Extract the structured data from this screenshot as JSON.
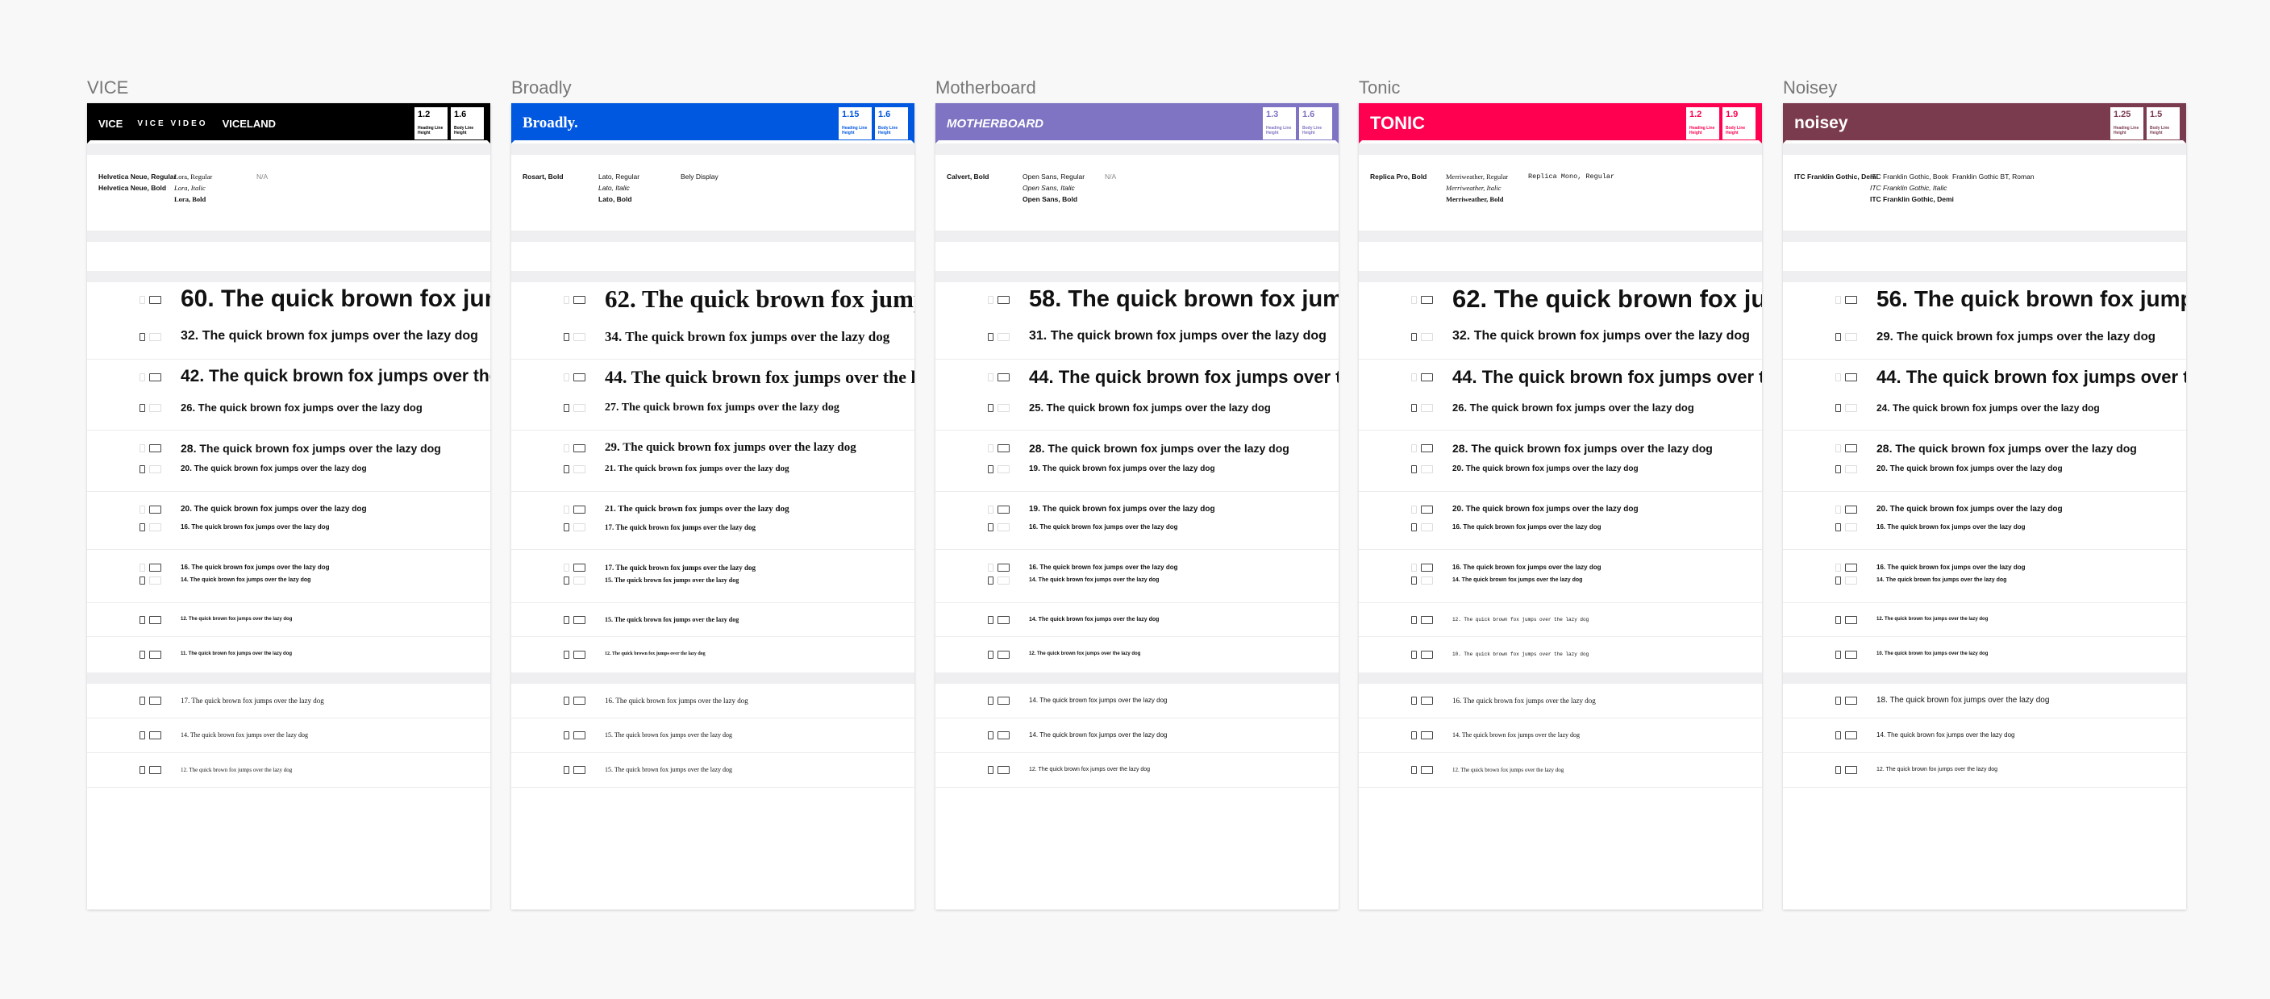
{
  "sample_text": "The quick brown fox jumps over the lazy dog",
  "cards": [
    {
      "id": "vice",
      "label": "VICE",
      "banner_color": "#000000",
      "logo_color": "#ffffff",
      "logo": [
        "VICE",
        "VICE VIDEO",
        "VICELAND"
      ],
      "metrics": [
        {
          "value": "1.2",
          "label": "Heading Line Height"
        },
        {
          "value": "1.6",
          "label": "Body Line Height"
        }
      ],
      "families": {
        "headline": [
          "Helvetica Neue, Regular",
          "Helvetica Neue, Bold"
        ],
        "body": [
          "Lora, Regular",
          "Lora, Italic",
          "Lora, Bold"
        ],
        "ui": [
          "N/A"
        ]
      },
      "accent": "#999999",
      "headings": [
        [
          "60",
          "32"
        ],
        [
          "42",
          "26"
        ],
        [
          "28",
          "20"
        ],
        [
          "20",
          "16"
        ],
        [
          "16",
          "14"
        ],
        [
          "12"
        ],
        [
          "11"
        ]
      ],
      "body": [
        "17",
        "14",
        "12"
      ]
    },
    {
      "id": "broadly",
      "label": "Broadly",
      "banner_color": "#0057e0",
      "logo_color": "#ffffff",
      "logo": [
        "Broadly."
      ],
      "metrics": [
        {
          "value": "1.15",
          "label": "Heading Line Height"
        },
        {
          "value": "1.6",
          "label": "Body Line Height"
        }
      ],
      "families": {
        "headline": [
          "Rosart, Bold"
        ],
        "body": [
          "Lato, Regular",
          "Lato, Italic",
          "Lato, Bold"
        ],
        "ui": [
          "Bely Display"
        ]
      },
      "accent": "#0057e0",
      "headings": [
        [
          "62",
          "34"
        ],
        [
          "44",
          "27"
        ],
        [
          "29",
          "21"
        ],
        [
          "21",
          "17"
        ],
        [
          "17",
          "15"
        ],
        [
          "15"
        ],
        [
          "12"
        ]
      ],
      "body": [
        "16",
        "15",
        "15"
      ]
    },
    {
      "id": "motherboard",
      "label": "Motherboard",
      "banner_color": "#7e74c3",
      "logo_color": "#ffffff",
      "logo": [
        "MOTHERBOARD"
      ],
      "metrics": [
        {
          "value": "1.3",
          "label": "Heading Line Height"
        },
        {
          "value": "1.6",
          "label": "Body Line Height"
        }
      ],
      "families": {
        "headline": [
          "Calvert, Bold"
        ],
        "body": [
          "Open Sans, Regular",
          "Open Sans, Italic",
          "Open Sans, Bold"
        ],
        "ui": [
          "N/A"
        ]
      },
      "accent": "#7e74c3",
      "headings": [
        [
          "58",
          "31"
        ],
        [
          "44",
          "25"
        ],
        [
          "28",
          "19"
        ],
        [
          "19",
          "16"
        ],
        [
          "16",
          "14"
        ],
        [
          "14"
        ],
        [
          "12"
        ]
      ],
      "body": [
        "14",
        "14",
        "12"
      ]
    },
    {
      "id": "tonic",
      "label": "Tonic",
      "banner_color": "#ff0050",
      "logo_color": "#ffffff",
      "logo": [
        "TONIC"
      ],
      "metrics": [
        {
          "value": "1.2",
          "label": "Heading Line Height"
        },
        {
          "value": "1.9",
          "label": "Body Line Height"
        }
      ],
      "families": {
        "headline": [
          "Replica Pro, Bold"
        ],
        "body": [
          "Merriweather, Regular",
          "Merriweather, Italic",
          "Merriweather, Bold"
        ],
        "ui": [
          "Replica Mono, Regular"
        ]
      },
      "accent": "#ff0050",
      "headings": [
        [
          "62",
          "32"
        ],
        [
          "44",
          "26"
        ],
        [
          "28",
          "20"
        ],
        [
          "20",
          "16"
        ],
        [
          "16",
          "14"
        ],
        [
          "12"
        ],
        [
          "10"
        ]
      ],
      "body": [
        "16",
        "14",
        "12"
      ]
    },
    {
      "id": "noisey",
      "label": "Noisey",
      "banner_color": "#7b3b4e",
      "logo_color": "#ffffff",
      "logo": [
        "noisey"
      ],
      "metrics": [
        {
          "value": "1.25",
          "label": "Heading Line Height"
        },
        {
          "value": "1.5",
          "label": "Body Line Height"
        }
      ],
      "families": {
        "headline": [
          "ITC Franklin Gothic, Demi"
        ],
        "body": [
          "ITC Franklin Gothic, Book",
          "ITC Franklin Gothic, Italic",
          "ITC Franklin Gothic, Demi"
        ],
        "ui": [
          "Franklin Gothic BT, Roman"
        ]
      },
      "accent": "#b0145a",
      "headings": [
        [
          "56",
          "29"
        ],
        [
          "44",
          "24"
        ],
        [
          "28",
          "20"
        ],
        [
          "20",
          "16"
        ],
        [
          "16",
          "14"
        ],
        [
          "12"
        ],
        [
          "10"
        ]
      ],
      "body": [
        "18",
        "14",
        "12"
      ]
    }
  ]
}
